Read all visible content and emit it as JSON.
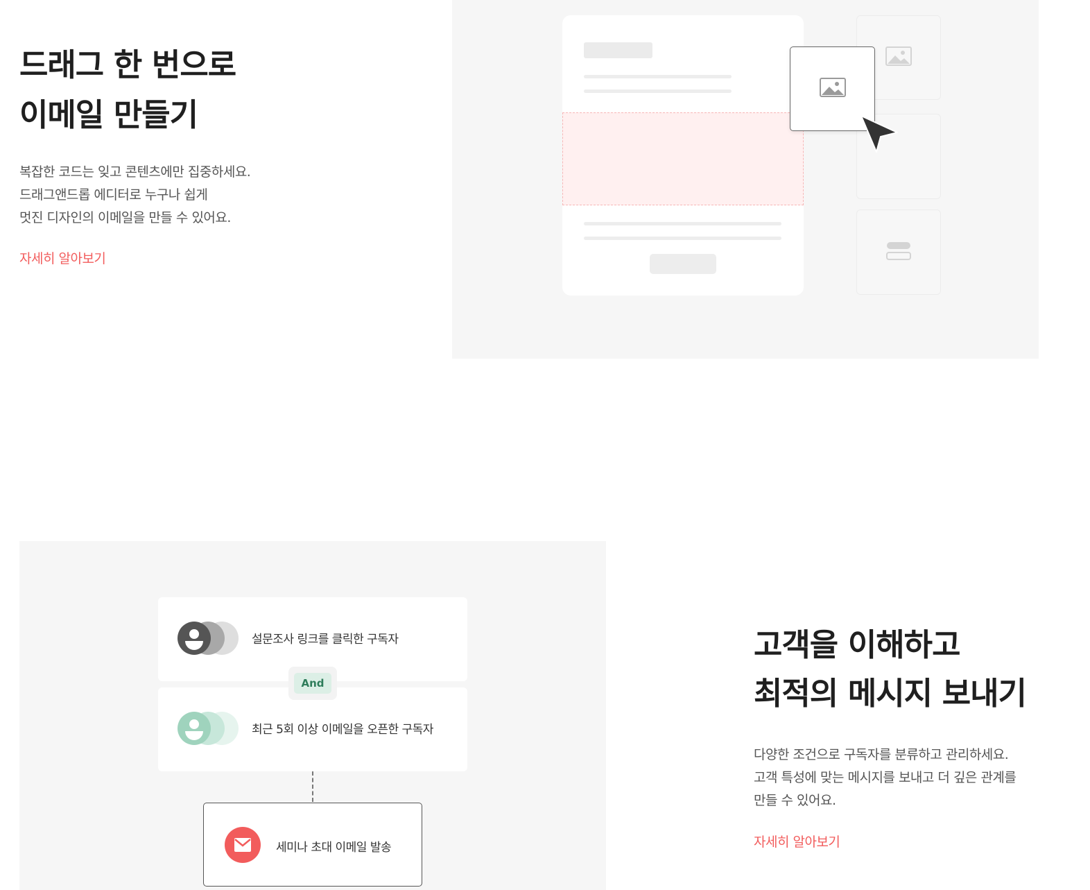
{
  "section_drag": {
    "title_lines": [
      "드래그 한 번으로",
      "이메일 만들기"
    ],
    "description_lines": [
      "복잡한 코드는 잊고 콘텐츠에만 집중하세요.",
      "드래그앤드롭 에디터로 누구나 쉽게",
      "멋진 디자인의 이메일을 만들 수 있어요."
    ],
    "link_label": "자세히 알아보기",
    "illustration": {
      "icons": [
        "image-icon",
        "image-icon",
        "button-block-icon",
        "cursor-arrow-icon"
      ]
    }
  },
  "section_segment": {
    "title_lines": [
      "고객을 이해하고",
      "최적의 메시지 보내기"
    ],
    "description_lines": [
      "다양한 조건으로 구독자를 분류하고 관리하세요.",
      "고객 특성에 맞는 메시지를 보내고 더 깊은 관계를",
      "만들 수 있어요."
    ],
    "link_label": "자세히 알아보기",
    "illustration": {
      "condition_1": "설문조사 링크를 클릭한 구독자",
      "operator": "And",
      "condition_2": "최근 5회 이상 이메일을 오픈한 구독자",
      "action": "세미나 초대 이메일 발송",
      "icons": [
        "subscriber-group-icon",
        "subscriber-group-icon",
        "mail-icon"
      ]
    }
  },
  "colors": {
    "accent": "#f25c5c",
    "panel_bg": "#f6f6f6",
    "and_badge_bg": "#dcefe6",
    "and_badge_text": "#2f7d5b",
    "avatar_dark": "#555555",
    "avatar_green": "#9fd3bd"
  }
}
